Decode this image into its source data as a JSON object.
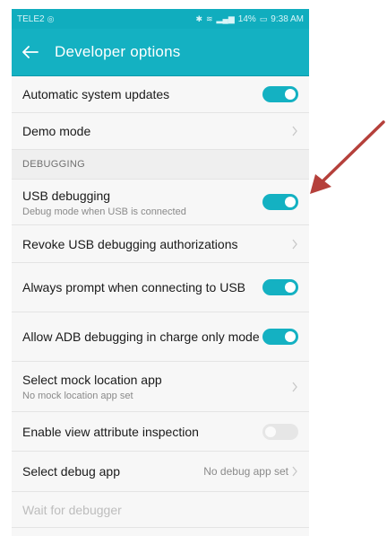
{
  "status_bar": {
    "carrier": "TELE2",
    "battery": "14%",
    "time": "9:38 AM"
  },
  "app_bar": {
    "title": "Developer options",
    "back_icon": "arrow-left-icon"
  },
  "rows_top": [
    {
      "label": "Automatic system updates",
      "control": "toggle",
      "on": true
    },
    {
      "label": "Demo mode",
      "control": "chevron"
    }
  ],
  "section": {
    "label": "DEBUGGING"
  },
  "rows": [
    {
      "label": "USB debugging",
      "sub": "Debug mode when USB is connected",
      "control": "toggle",
      "on": true
    },
    {
      "label": "Revoke USB debugging authorizations",
      "control": "chevron"
    },
    {
      "label": "Always prompt when connecting to USB",
      "control": "toggle",
      "on": true
    },
    {
      "label": "Allow ADB debugging in charge only mode",
      "control": "toggle",
      "on": true
    },
    {
      "label": "Select mock location app",
      "sub": "No mock location app set",
      "control": "chevron"
    },
    {
      "label": "Enable view attribute inspection",
      "control": "toggle",
      "on": false
    },
    {
      "label": "Select debug app",
      "value": "No debug app set",
      "control": "chevron"
    },
    {
      "label": "Wait for debugger",
      "control": "none",
      "disabled": true
    }
  ],
  "colors": {
    "accent": "#14b1c2",
    "annotation_arrow": "#b5403b"
  }
}
